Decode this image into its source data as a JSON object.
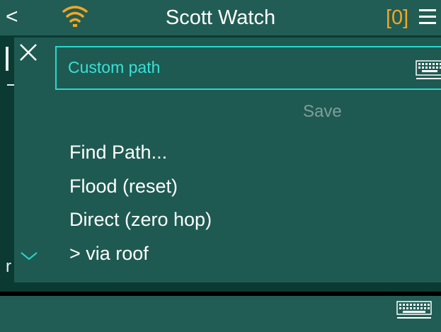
{
  "header": {
    "back_label": "<",
    "title": "Scott Watch",
    "counter": "[0]",
    "wifi_icon": "wifi-icon",
    "menu_icon": "hamburger-menu-icon",
    "counter_color": "#f5a623"
  },
  "popup": {
    "close_icon": "close-icon",
    "path_field": {
      "value": "Custom path",
      "keyboard_icon": "keyboard-icon"
    },
    "save_label": "Save",
    "options": [
      {
        "label": "Find Path...",
        "selected": false
      },
      {
        "label": "Flood (reset)",
        "selected": false
      },
      {
        "label": "Direct (zero hop)",
        "selected": false
      },
      {
        "label": "> via roof",
        "selected": true
      }
    ],
    "check_icon": "checkmark-icon"
  },
  "background": {
    "partial_glyph": "r"
  },
  "bottom_bar": {
    "keyboard_icon": "keyboard-icon"
  },
  "colors": {
    "header_bg": "#215d54",
    "popup_bg": "#1e5a51",
    "accent": "#29d9d1",
    "wifi": "#f5a623"
  }
}
